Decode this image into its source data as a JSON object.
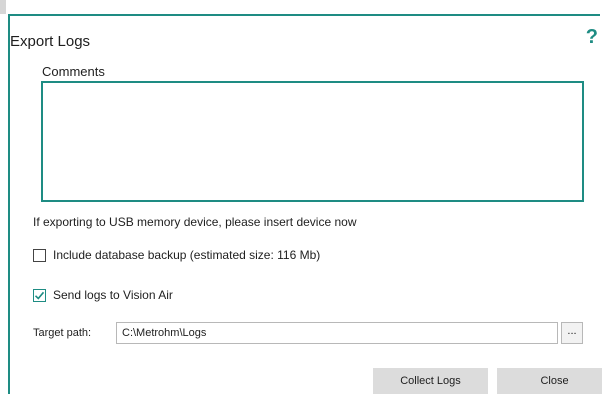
{
  "dialog": {
    "title": "Export Logs",
    "help_icon": "?",
    "comments_label": "Comments",
    "comments_value": "",
    "info_text": "If exporting to USB memory device, please insert device now",
    "include_backup": {
      "label": "Include database backup (estimated size: 116 Mb)",
      "checked": false
    },
    "send_logs": {
      "label": "Send logs to Vision Air",
      "checked": true
    },
    "target_path_label": "Target path:",
    "target_path_value": "C:\\Metrohm\\Logs",
    "browse_label": "...",
    "collect_button": "Collect Logs",
    "close_button": "Close"
  },
  "colors": {
    "accent": "#1e8c83",
    "button_bg": "#dcdcdc"
  }
}
